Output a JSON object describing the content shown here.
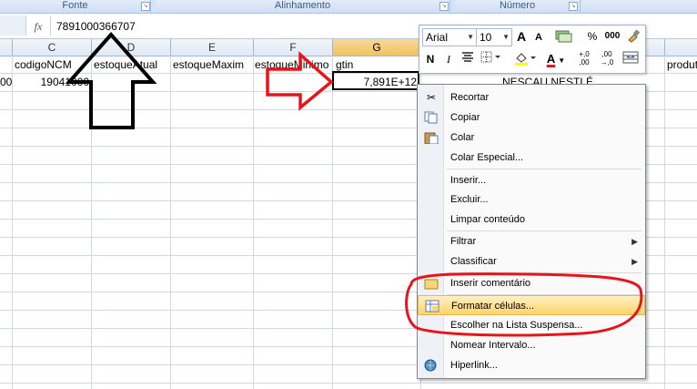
{
  "ribbon": {
    "groups": [
      "Fonte",
      "Alinhamento",
      "Número"
    ]
  },
  "formula_bar": {
    "fx_label": "fx",
    "value": "7891000366707"
  },
  "columns": [
    {
      "letter": "C",
      "header": "codigoNCM"
    },
    {
      "letter": "D",
      "header": "estoqueAtual"
    },
    {
      "letter": "E",
      "header": "estoqueMaxim"
    },
    {
      "letter": "F",
      "header": "estoqueMinimo"
    },
    {
      "letter": "G",
      "header": "gtin"
    }
  ],
  "extra_header": "produt",
  "row_values": {
    "b_fragment": "00",
    "ncm": "19041000",
    "gtin": "7,891E+12",
    "product": "NESCAU NESTLÉ"
  },
  "mini_toolbar": {
    "font": "Arial",
    "size": "10",
    "grow": "A",
    "shrink": "A",
    "percent": "%",
    "thousands": "000",
    "bold": "N",
    "italic": "I",
    "decimal_inc": "+,0\n,00",
    "decimal_dec": ",00\n→,0",
    "font_color": "A"
  },
  "context_menu": {
    "items": [
      {
        "label": "Recortar",
        "icon": "scissors-icon",
        "glyph": "✂"
      },
      {
        "label": "Copiar",
        "icon": "copy-icon",
        "glyph": "⎘"
      },
      {
        "label": "Colar",
        "icon": "paste-icon",
        "glyph": "📋"
      },
      {
        "label": "Colar Especial...",
        "icon": "",
        "glyph": ""
      },
      {
        "label": "Inserir...",
        "icon": "",
        "glyph": ""
      },
      {
        "label": "Excluir...",
        "icon": "",
        "glyph": ""
      },
      {
        "label": "Limpar conteúdo",
        "icon": "",
        "glyph": ""
      },
      {
        "label": "Filtrar",
        "icon": "",
        "glyph": ""
      },
      {
        "label": "Classificar",
        "icon": "",
        "glyph": ""
      },
      {
        "label": "Inserir comentário",
        "icon": "comment-icon",
        "glyph": ""
      },
      {
        "label": "Formatar células...",
        "icon": "format-cells-icon",
        "glyph": ""
      },
      {
        "label": "Escolher na Lista Suspensa...",
        "icon": "",
        "glyph": ""
      },
      {
        "label": "Nomear Intervalo...",
        "icon": "",
        "glyph": ""
      },
      {
        "label": "Hiperlink...",
        "icon": "hyperlink-icon",
        "glyph": ""
      }
    ],
    "submenu_arrow": "▶"
  },
  "colors": {
    "annotation_red": "#e8141c",
    "annotation_black": "#000000",
    "highlight": "#ffd36b",
    "header_selected": "#f1c15f"
  }
}
